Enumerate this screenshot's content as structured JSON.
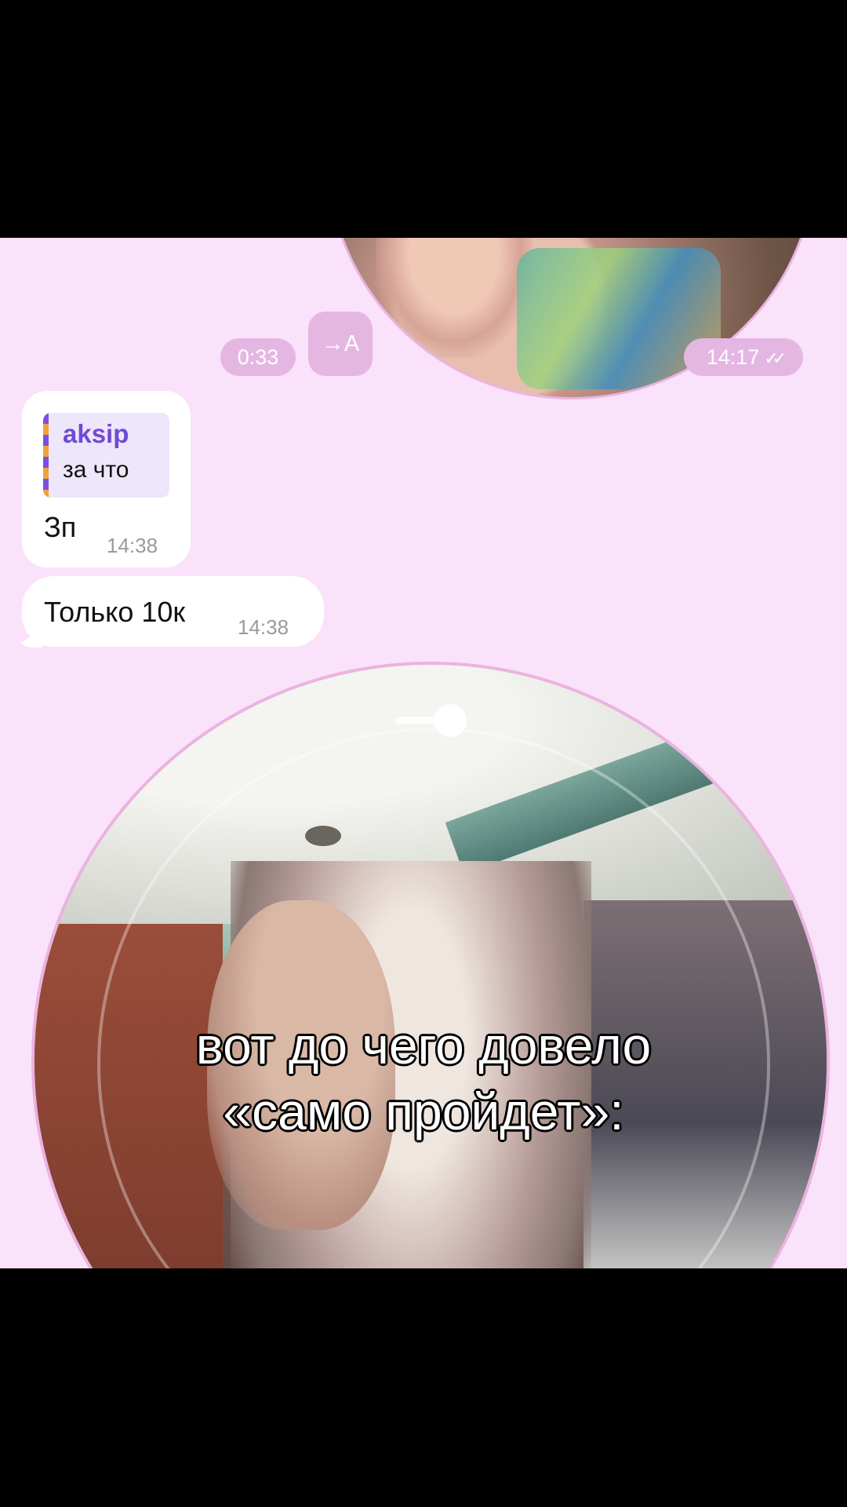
{
  "video_note_top": {
    "duration": "0:33",
    "forward_label": "→A",
    "time": "14:17",
    "read_status": "✓✓"
  },
  "messages": [
    {
      "reply_author": "aksip",
      "reply_text": "за что",
      "text": "Зп",
      "time": "14:38"
    },
    {
      "text": "Только 10к",
      "time": "14:38"
    }
  ],
  "caption": {
    "line1": "вот до чего довело",
    "line2": "«само пройдет»:"
  },
  "colors": {
    "chat_background": "#f9e2fa",
    "badge": "#e4b7e3",
    "reply_author": "#7149d6",
    "video_border": "#ebb3e0"
  }
}
